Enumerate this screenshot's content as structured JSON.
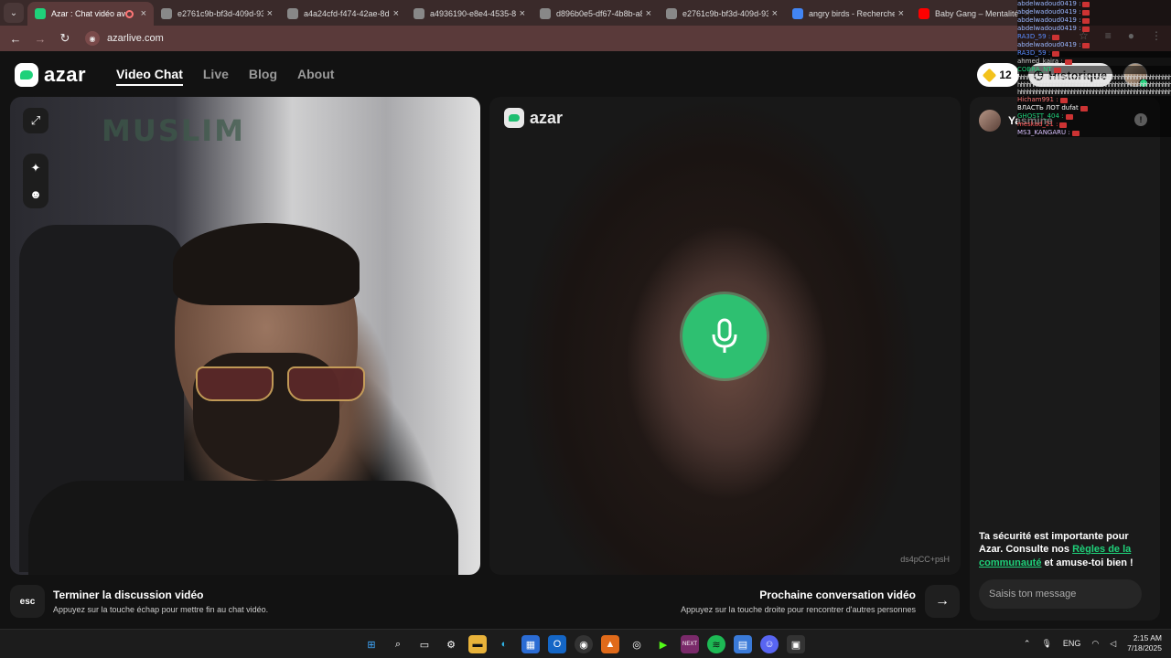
{
  "browser": {
    "tabs": [
      {
        "title": "Azar : Chat vidéo ave",
        "active": true,
        "favicon_color": "#1fd17a"
      },
      {
        "title": "e2761c9b-bf3d-409d-93c",
        "active": false,
        "favicon_color": "#888888"
      },
      {
        "title": "a4a24cfd-f474-42ae-8db",
        "active": false,
        "favicon_color": "#888888"
      },
      {
        "title": "a4936190-e8e4-4535-8d",
        "active": false,
        "favicon_color": "#888888"
      },
      {
        "title": "d896b0e5-df67-4b8b-a8",
        "active": false,
        "favicon_color": "#888888"
      },
      {
        "title": "e2761c9b-bf3d-409d-93c",
        "active": false,
        "favicon_color": "#888888"
      },
      {
        "title": "angry birds - Recherche G",
        "active": false,
        "favicon_color": "#4285f4"
      },
      {
        "title": "Baby Gang – Mentalité [C",
        "active": false,
        "favicon_color": "#ff0000"
      }
    ],
    "url": "azarlive.com"
  },
  "app": {
    "logo": "azar",
    "nav": {
      "video_chat": "Video Chat",
      "live": "Live",
      "blog": "Blog",
      "about": "About"
    },
    "gems_count": "12",
    "history_label": "Historique",
    "peer_name": "Yasmine",
    "stream_id": "ds4pCC+psH",
    "safety_text_1": "Ta sécurité est importante pour Azar. Consulte nos ",
    "safety_link": "Règles de la communauté",
    "safety_text_2": " et amuse-toi bien !",
    "message_placeholder": "Saisis ton message",
    "end": {
      "key": "esc",
      "title": "Terminer la discussion vidéo",
      "subtitle": "Appuyez sur la touche échap pour mettre fin au chat vidéo."
    },
    "next": {
      "title": "Prochaine conversation vidéo",
      "subtitle": "Appuyez sur la touche droite pour rencontrer d'autres personnes"
    },
    "accent_color": "#1fd17a"
  },
  "overlay": {
    "lines": [
      {
        "user": "abdelwadoud0419 :",
        "color": "#9ab7ff"
      },
      {
        "user": "abdelwadoud0419 :",
        "color": "#9ab7ff"
      },
      {
        "user": "abdelwadoud0419 :",
        "color": "#9ab7ff"
      },
      {
        "user": "abdelwadoud0419 :",
        "color": "#9ab7ff"
      },
      {
        "user": "RA3D_59 :",
        "color": "#5a8cff"
      },
      {
        "user": "abdelwadoud0419 :",
        "color": "#9ab7ff"
      },
      {
        "user": "RA3D_59 :",
        "color": "#5a8cff"
      },
      {
        "user": "ahmed_kaira :",
        "color": "#cccccc"
      },
      {
        "user": "COBRA_NT",
        "color": "#1fd17a"
      },
      {
        "user": "Hicham991 :",
        "color": "#ff7777"
      },
      {
        "user": "ВЛАСТЬ ЛОТ dufat",
        "color": "#ffffff"
      },
      {
        "user": "GHOSTT_404 :",
        "color": "#1fd17a"
      },
      {
        "user": "meskad_21 :",
        "color": "#ff5555"
      },
      {
        "user": "MS3_KANGARU :",
        "color": "#d9c2ff"
      }
    ],
    "spam": "hhhhhhhhhhhhhhhhhhhhhhhhhhhhhhhhhhhhhhhhhhhhhhhhhhhhhhhhhhhhhhhhhh"
  },
  "taskbar": {
    "lang": "ENG",
    "time": "2:15 AM",
    "date": "7/18/2025"
  }
}
